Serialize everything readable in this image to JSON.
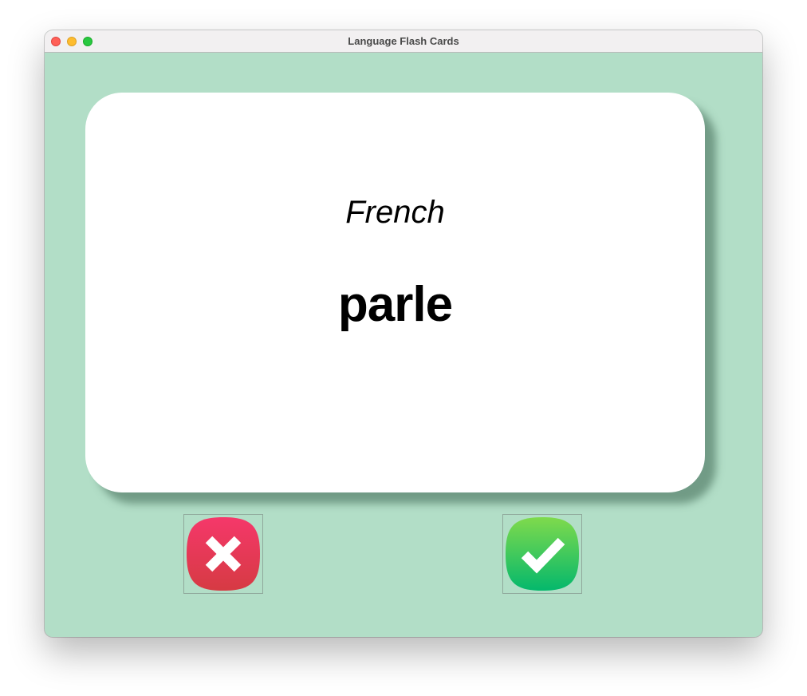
{
  "window": {
    "title": "Language Flash Cards"
  },
  "card": {
    "language": "French",
    "word": "parle"
  },
  "buttons": {
    "wrong_icon": "x-mark-icon",
    "right_icon": "checkmark-icon"
  },
  "colors": {
    "background": "#b2dec7",
    "card": "#ffffff",
    "wrong_top": "#f5386a",
    "wrong_bottom": "#d63a43",
    "right_top": "#7fda4c",
    "right_bottom": "#04b86c"
  }
}
